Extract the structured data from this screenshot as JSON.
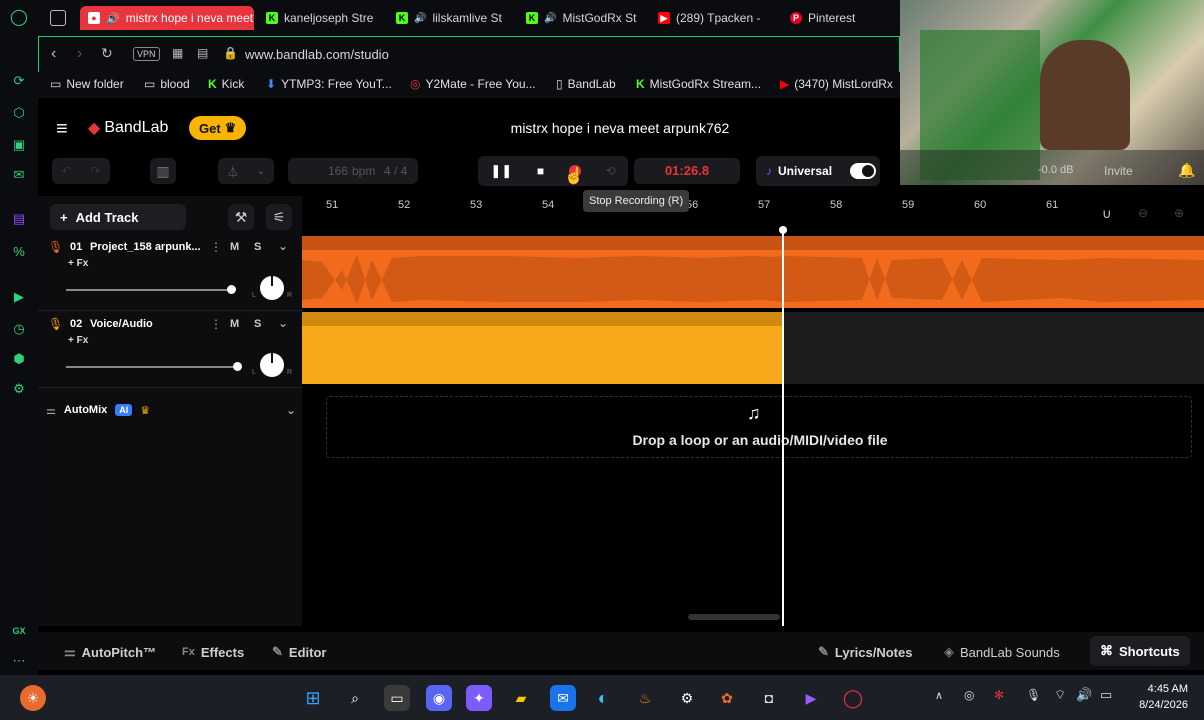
{
  "browser": {
    "tabs": [
      {
        "label": "mistrx hope i neva meet",
        "active": true,
        "icon": "bandlab-icon"
      },
      {
        "label": "kaneljoseph Stre",
        "active": false,
        "icon": "kick-icon"
      },
      {
        "label": "lilskamlive St",
        "active": false,
        "icon": "kick-icon"
      },
      {
        "label": "MistGodRx St",
        "active": false,
        "icon": "kick-icon"
      },
      {
        "label": "(289) Tpacken -",
        "active": false,
        "icon": "youtube-icon"
      },
      {
        "label": "Pinterest",
        "active": false,
        "icon": "pinterest-icon"
      }
    ],
    "url": "www.bandlab.com/studio",
    "vpn_label": "VPN",
    "bookmarks": [
      {
        "label": "New folder",
        "icon": "folder-icon"
      },
      {
        "label": "blood",
        "icon": "folder-icon"
      },
      {
        "label": "Kick",
        "icon": "kick-icon"
      },
      {
        "label": "YTMP3: Free YouT...",
        "icon": "download-icon"
      },
      {
        "label": "Y2Mate - Free You...",
        "icon": "y2mate-icon"
      },
      {
        "label": "BandLab",
        "icon": "page-icon"
      },
      {
        "label": "MistGodRx Stream...",
        "icon": "kick-icon"
      },
      {
        "label": "(3470) MistLordRx",
        "icon": "youtube-icon"
      }
    ]
  },
  "studio": {
    "logo_text": "BandLab",
    "get_label": "Get",
    "project_title": "mistrx hope i neva meet arpunk762",
    "bpm_value": "166",
    "bpm_unit": "bpm",
    "time_signature": "4 / 4",
    "time_display": "01:26.8",
    "tooltip": "Stop Recording (R)",
    "sound_label": "Universal",
    "volume_label": "-0.0 dB",
    "invite_label": "Invite",
    "add_track_label": "Add Track",
    "ruler_marks": [
      "51",
      "52",
      "53",
      "54",
      "56",
      "57",
      "58",
      "59",
      "60",
      "61"
    ],
    "tracks": [
      {
        "number": "01",
        "name": "Project_158 arpunk...",
        "fx": "+ Fx",
        "mute": "M",
        "solo": "S",
        "color": "#f26a1b",
        "volume": 0.88
      },
      {
        "number": "02",
        "name": "Voice/Audio",
        "fx": "+ Fx",
        "mute": "M",
        "solo": "S",
        "color": "#f7a91b",
        "volume": 0.9
      }
    ],
    "automix_label": "AutoMix",
    "ai_badge": "AI",
    "drop_text": "Drop a loop or an audio/MIDI/video file",
    "pan_left": "L",
    "pan_right": "R"
  },
  "bottom_bar": {
    "autopitch": "AutoPitch™",
    "effects": "Effects",
    "fx_prefix": "Fx",
    "editor": "Editor",
    "lyrics": "Lyrics/Notes",
    "sounds": "BandLab Sounds",
    "shortcuts": "Shortcuts"
  },
  "taskbar": {
    "time": "4:45 AM",
    "date": "8/24/2026"
  },
  "colors": {
    "accent_green": "#1ad26d",
    "bandlab_red": "#e8343d",
    "track1_orange": "#f26a1b",
    "track2_yellow": "#f7a91b",
    "get_yellow": "#f8b400"
  }
}
